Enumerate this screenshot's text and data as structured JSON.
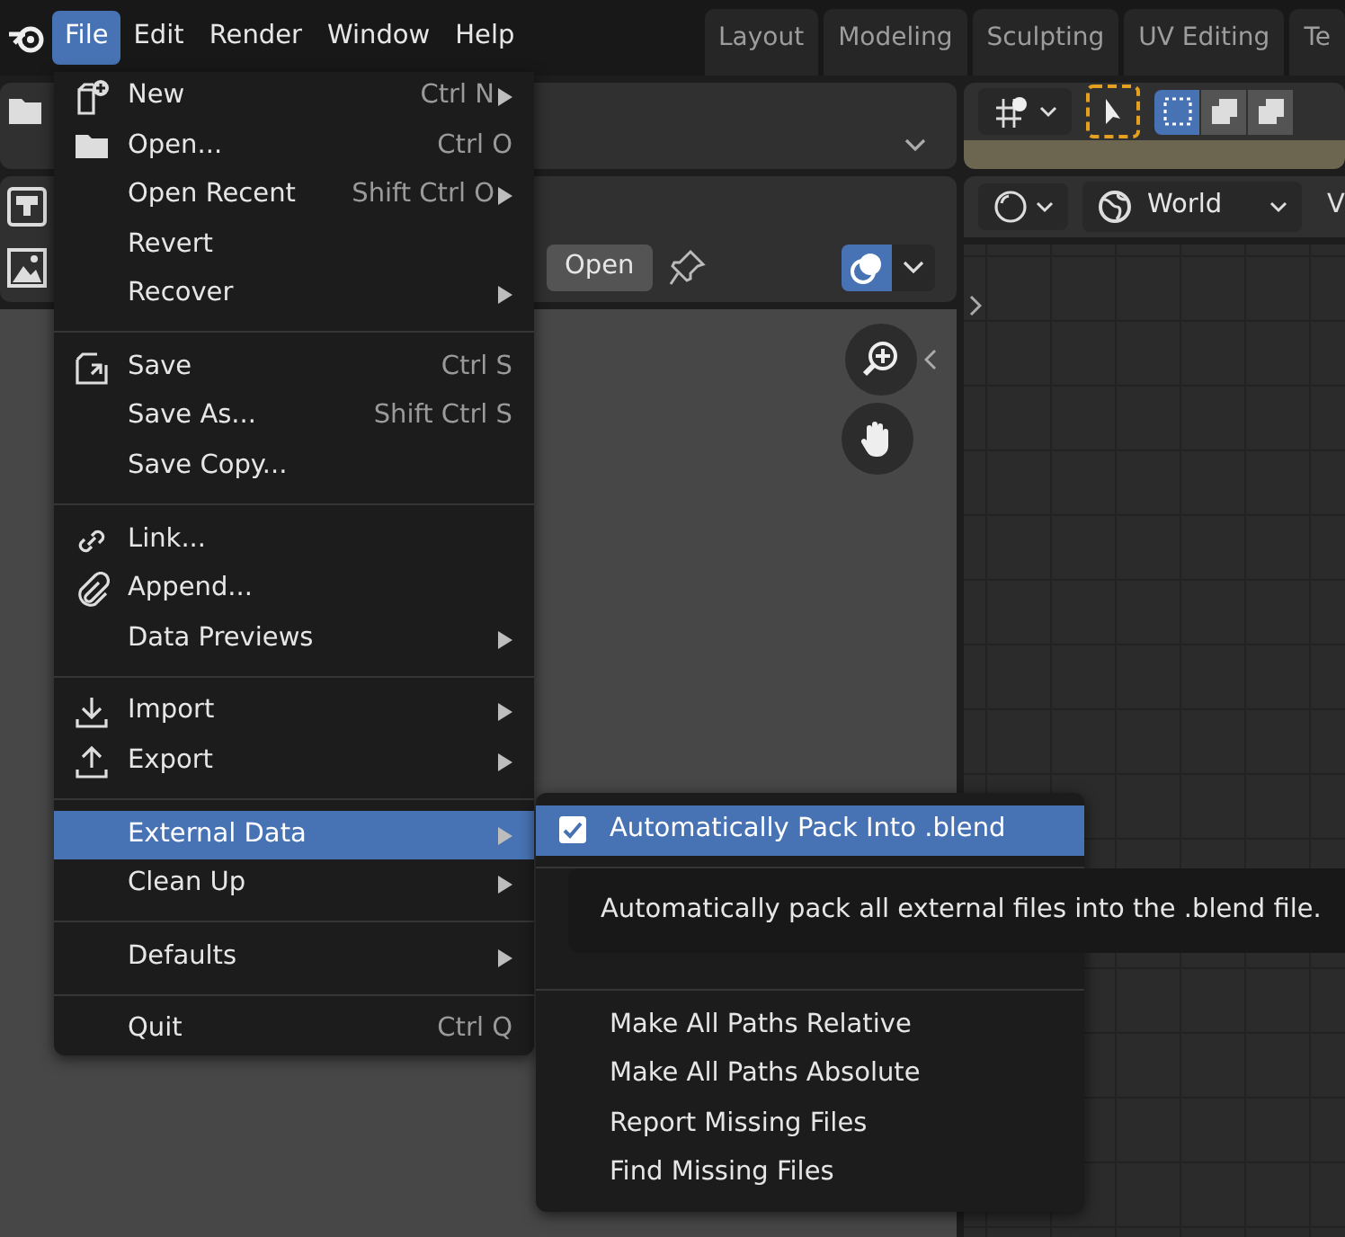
{
  "menubar": {
    "items": [
      {
        "label": "File",
        "selected": true
      },
      {
        "label": "Edit",
        "selected": false
      },
      {
        "label": "Render",
        "selected": false
      },
      {
        "label": "Window",
        "selected": false
      },
      {
        "label": "Help",
        "selected": false
      }
    ]
  },
  "workspace_tabs": [
    {
      "label": "Layout",
      "selected": false
    },
    {
      "label": "Modeling",
      "selected": false
    },
    {
      "label": "Sculpting",
      "selected": false
    },
    {
      "label": "UV Editing",
      "selected": false
    },
    {
      "label": "Te",
      "selected": false
    }
  ],
  "image_editor": {
    "open_button": "Open",
    "overlay_on": true
  },
  "viewport": {
    "world_dropdown": "World",
    "header_cut": "V",
    "selection_modes": [
      {
        "selected": true
      },
      {
        "selected": false
      },
      {
        "selected": false
      }
    ]
  },
  "file_menu": {
    "items": [
      {
        "kind": "item",
        "label": "New",
        "shortcut": "Ctrl N",
        "submenu": true,
        "highlighted": false
      },
      {
        "kind": "item",
        "label": "Open...",
        "shortcut": "Ctrl O",
        "submenu": false,
        "highlighted": false
      },
      {
        "kind": "item",
        "label": "Open Recent",
        "shortcut": "Shift Ctrl O",
        "submenu": true,
        "highlighted": false
      },
      {
        "kind": "item",
        "label": "Revert",
        "submenu": false,
        "highlighted": false
      },
      {
        "kind": "item",
        "label": "Recover",
        "submenu": true,
        "highlighted": false
      },
      {
        "kind": "separator"
      },
      {
        "kind": "item",
        "label": "Save",
        "shortcut": "Ctrl S",
        "submenu": false,
        "highlighted": false
      },
      {
        "kind": "item",
        "label": "Save As...",
        "shortcut": "Shift Ctrl S",
        "submenu": false,
        "highlighted": false
      },
      {
        "kind": "item",
        "label": "Save Copy...",
        "submenu": false,
        "highlighted": false
      },
      {
        "kind": "separator"
      },
      {
        "kind": "item",
        "label": "Link...",
        "submenu": false,
        "highlighted": false
      },
      {
        "kind": "item",
        "label": "Append...",
        "submenu": false,
        "highlighted": false
      },
      {
        "kind": "item",
        "label": "Data Previews",
        "submenu": true,
        "highlighted": false
      },
      {
        "kind": "separator"
      },
      {
        "kind": "item",
        "label": "Import",
        "submenu": true,
        "highlighted": false
      },
      {
        "kind": "item",
        "label": "Export",
        "submenu": true,
        "highlighted": false
      },
      {
        "kind": "separator"
      },
      {
        "kind": "item",
        "label": "External Data",
        "submenu": true,
        "highlighted": true
      },
      {
        "kind": "item",
        "label": "Clean Up",
        "submenu": true,
        "highlighted": false
      },
      {
        "kind": "separator"
      },
      {
        "kind": "item",
        "label": "Defaults",
        "submenu": true,
        "highlighted": false
      },
      {
        "kind": "separator"
      },
      {
        "kind": "item",
        "label": "Quit",
        "shortcut": "Ctrl Q",
        "submenu": false,
        "highlighted": false
      }
    ]
  },
  "external_data_menu": {
    "items": [
      {
        "kind": "check",
        "label": "Automatically Pack Into .blend",
        "checked": true,
        "highlighted": true
      },
      {
        "kind": "separator"
      },
      {
        "kind": "separator"
      },
      {
        "kind": "item",
        "label": "Make All Paths Relative",
        "highlighted": false
      },
      {
        "kind": "item",
        "label": "Make All Paths Absolute",
        "highlighted": false
      },
      {
        "kind": "item",
        "label": "Report Missing Files",
        "highlighted": false
      },
      {
        "kind": "item",
        "label": "Find Missing Files",
        "highlighted": false
      }
    ],
    "tooltip": "Automatically pack all external files into the .blend file."
  }
}
